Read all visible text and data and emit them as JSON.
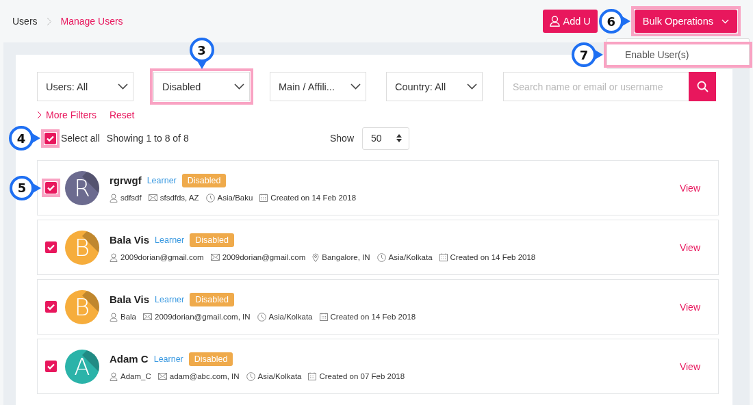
{
  "breadcrumb": [
    {
      "label": "Users",
      "selected": false
    },
    {
      "label": "Manage Users",
      "selected": true
    }
  ],
  "actions": {
    "add_user": {
      "label": "Add U"
    },
    "bulk": {
      "label": "Bulk Operations",
      "expanded": true,
      "highlighted": true,
      "callout": "6",
      "menu": [
        {
          "label": "Enable User(s)",
          "highlighted": true,
          "callout": "7"
        }
      ]
    }
  },
  "filters": [
    {
      "value": "Users: All",
      "highlighted": false
    },
    {
      "value": "Disabled",
      "highlighted": true,
      "callout": "3"
    },
    {
      "value": "Main / Affili...",
      "highlighted": false
    },
    {
      "value": "Country: All",
      "highlighted": false
    }
  ],
  "search": {
    "placeholder": "Search name or email or username"
  },
  "links": [
    "More Filters",
    "Reset"
  ],
  "select_all": {
    "label": "Select all",
    "checked": true,
    "highlighted": true,
    "callout": "4"
  },
  "showing": "Showing 1 to 8 of 8",
  "page_size": {
    "label": "Show",
    "value": "50"
  },
  "users": [
    {
      "name": "rgrwgf",
      "initial": "R",
      "color": "#6c6b8f",
      "role": "Learner",
      "status": "Disabled",
      "checked": true,
      "highlighted": true,
      "callout": "5",
      "action": "View",
      "meta": [
        {
          "kind": "user",
          "text": "sdfsdf"
        },
        {
          "kind": "email",
          "text": "sfsdfds, AZ"
        },
        {
          "kind": "timezone",
          "text": "Asia/Baku"
        },
        {
          "kind": "created",
          "text": "Created on 14 Feb 2018"
        }
      ]
    },
    {
      "name": "Bala Vis",
      "initial": "B",
      "color": "#f6ad3c",
      "role": "Learner",
      "status": "Disabled",
      "checked": true,
      "highlighted": false,
      "action": "View",
      "meta": [
        {
          "kind": "user",
          "text": "2009dorian@gmail.com"
        },
        {
          "kind": "email",
          "text": "2009dorian@gmail.com"
        },
        {
          "kind": "location",
          "text": "Bangalore, IN"
        },
        {
          "kind": "timezone",
          "text": "Asia/Kolkata"
        },
        {
          "kind": "created",
          "text": "Created on 14 Feb 2018"
        }
      ]
    },
    {
      "name": "Bala Vis",
      "initial": "B",
      "color": "#f6ad3c",
      "role": "Learner",
      "status": "Disabled",
      "checked": true,
      "highlighted": false,
      "action": "View",
      "meta": [
        {
          "kind": "user",
          "text": "Bala"
        },
        {
          "kind": "email",
          "text": "2009dorian@gmail.com, IN"
        },
        {
          "kind": "timezone",
          "text": "Asia/Kolkata"
        },
        {
          "kind": "created",
          "text": "Created on 14 Feb 2018"
        }
      ]
    },
    {
      "name": "Adam C",
      "initial": "A",
      "color": "#2bb3a9",
      "role": "Learner",
      "status": "Disabled",
      "checked": true,
      "highlighted": false,
      "action": "View",
      "meta": [
        {
          "kind": "user",
          "text": "Adam_C"
        },
        {
          "kind": "email",
          "text": "adam@abc.com, IN"
        },
        {
          "kind": "timezone",
          "text": "Asia/Kolkata"
        },
        {
          "kind": "created",
          "text": "Created on 07 Feb 2018"
        }
      ]
    }
  ]
}
